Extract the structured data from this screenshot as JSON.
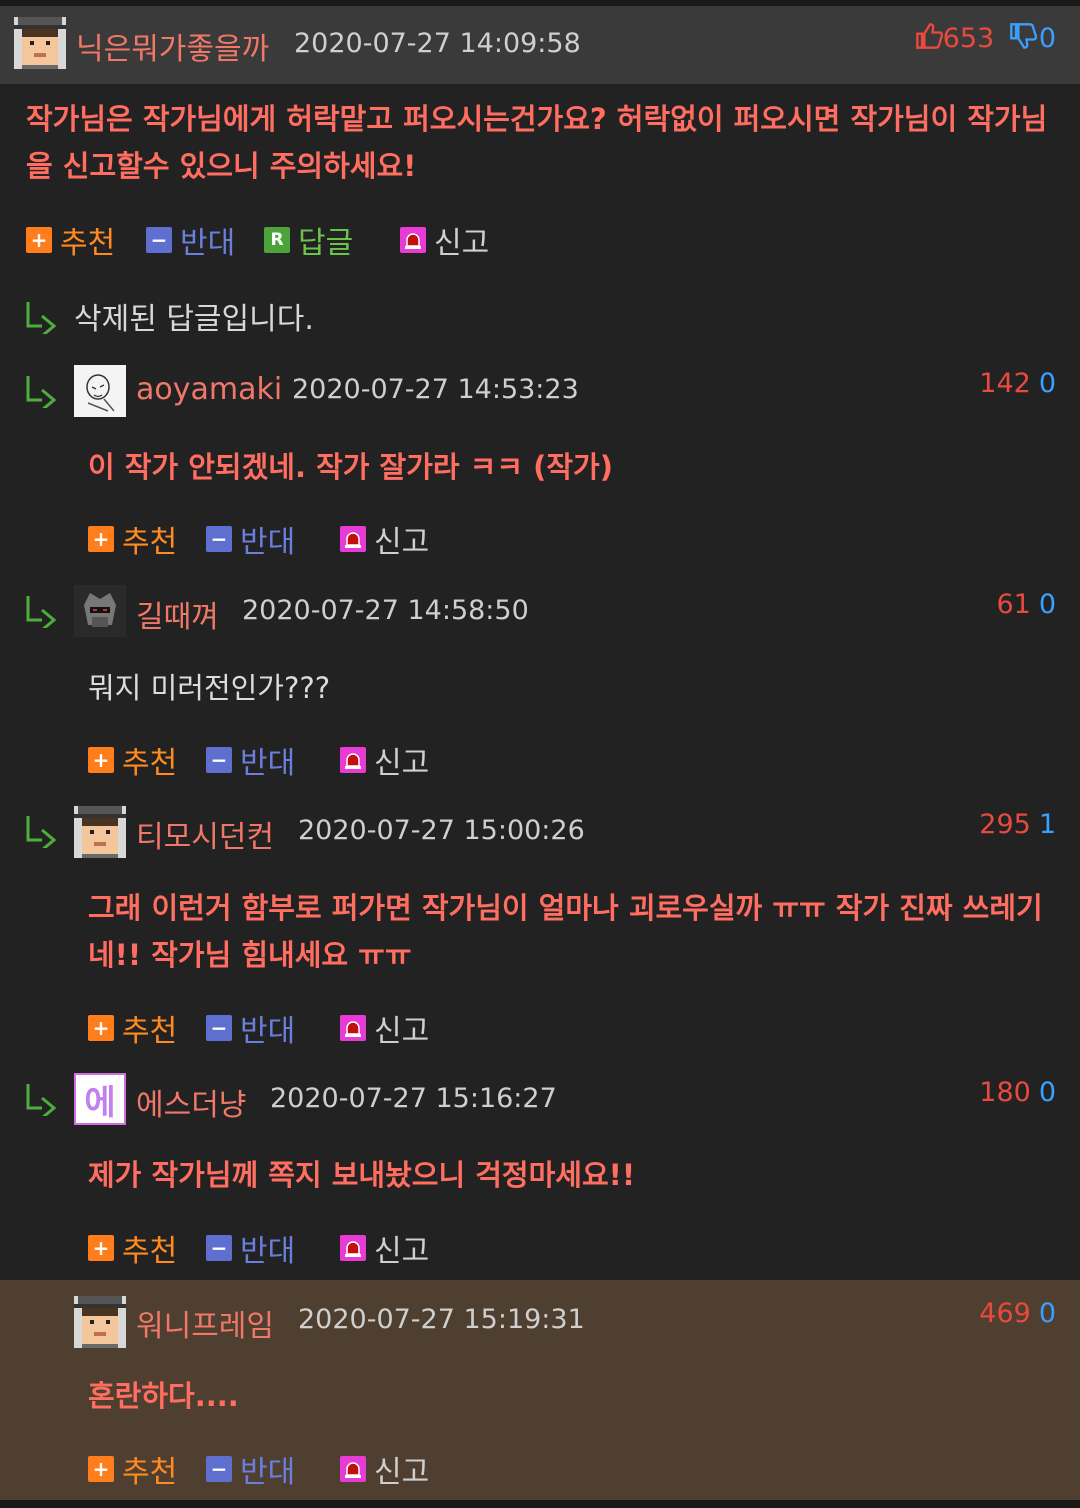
{
  "colors": {
    "accent_red": "#ff6e60",
    "up_vote": "#e84a3e",
    "down_vote": "#3aa0ff",
    "recommend": "#ff8a20",
    "oppose": "#6a7fdc",
    "reply": "#6cc24a",
    "report": "#e83bd6",
    "highlight_bg": "#4e3f30"
  },
  "actions": {
    "recommend": "추천",
    "oppose": "반대",
    "reply": "답글",
    "report": "신고",
    "recommend_icon": "+",
    "oppose_icon": "−",
    "reply_icon": "R"
  },
  "main_comment": {
    "nickname": "닉은뭐가좋을까",
    "date": "2020-07-27 14:09:58",
    "up": "653",
    "down": "0",
    "text": "작가님은 작가님에게 허락맡고 퍼오시는건가요? 허락없이 퍼오시면 작가님이 작가님을 신고할수 있으니 주의하세요!"
  },
  "deleted_reply": "삭제된 답글입니다.",
  "replies": [
    {
      "nickname": "aoyamaki",
      "date": "2020-07-27 14:53:23",
      "up": "142",
      "down": "0",
      "text": "이 작가 안되겠네. 작가 잘가라 ㅋㅋ (작가)"
    },
    {
      "nickname": "길때껴",
      "date": "2020-07-27 14:58:50",
      "up": "61",
      "down": "0",
      "text": "뭐지 미러전인가???"
    },
    {
      "nickname": "티모시던컨",
      "date": "2020-07-27 15:00:26",
      "up": "295",
      "down": "1",
      "text": "그래 이런거 함부로 퍼가면 작가님이 얼마나 괴로우실까 ㅠㅠ 작가 진짜 쓰레기네!! 작가님 힘내세요 ㅠㅠ"
    },
    {
      "nickname": "에스더냥",
      "date": "2020-07-27 15:16:27",
      "up": "180",
      "down": "0",
      "text": "제가 작가님께 쪽지 보내놨으니 걱정마세요!!",
      "avatar_text": "에"
    },
    {
      "nickname": "워니프레임",
      "date": "2020-07-27 15:19:31",
      "up": "469",
      "down": "0",
      "text": "혼란하다...."
    }
  ]
}
